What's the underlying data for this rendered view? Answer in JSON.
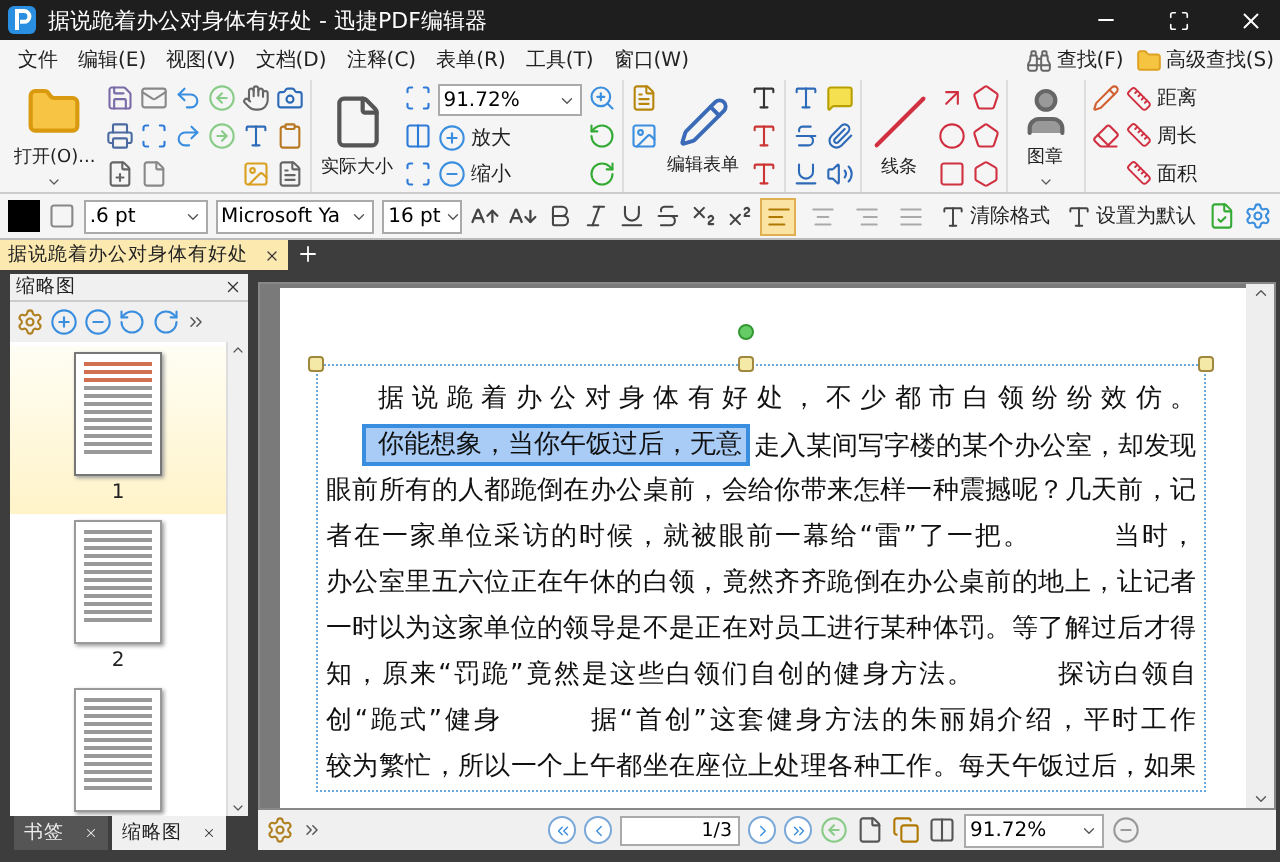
{
  "window": {
    "title": "据说跪着办公对身体有好处 - 迅捷PDF编辑器"
  },
  "menu": [
    "文件",
    "编辑(E)",
    "视图(V)",
    "文档(D)",
    "注释(C)",
    "表单(R)",
    "工具(T)",
    "窗口(W)"
  ],
  "search_links": [
    "查找(F)",
    "高级查找(S)"
  ],
  "ribbon": {
    "open": "打开(O)...",
    "actual_size": "实际大小",
    "zoom_value": "91.72%",
    "zoom_in": "放大",
    "zoom_out": "缩小",
    "edit_form": "编辑表单",
    "lines": "线条",
    "stamp": "图章",
    "measure": [
      "距离",
      "周长",
      "面积"
    ]
  },
  "format_bar": {
    "line_width": ".6 pt",
    "font": "Microsoft Ya",
    "font_size": "16 pt",
    "clear_format": "清除格式",
    "set_default": "设置为默认",
    "alignments": [
      {
        "selected": true
      },
      {
        "selected": false
      },
      {
        "selected": false
      },
      {
        "selected": false
      }
    ]
  },
  "doc_tabs": [
    {
      "label": "据说跪着办公对身体有好处",
      "selected": true
    }
  ],
  "thumbnail_panel": {
    "title": "缩略图",
    "pages": [
      {
        "label": "1",
        "selected": true
      },
      {
        "label": "2",
        "selected": false
      },
      {
        "selected": false
      }
    ]
  },
  "panel_tabs": [
    {
      "label": "书签",
      "selected": false
    },
    {
      "label": "缩略图",
      "selected": true
    }
  ],
  "document": {
    "lines": [
      {
        "text": "据说跪着办公对身体有好处，不少都市白领纷纷效仿。",
        "indent": true
      },
      {
        "highlight": "你能想象，当你午饭过后，无意",
        "text": "走入某间写字楼的某个办公室，却发现",
        "indent": true
      },
      {
        "text": "眼前所有的人都跪倒在办公桌前，会给你带来怎样一种震撼呢？几天前，记"
      },
      {
        "text": "者在一家单位采访的时候，就被眼前一幕给“雷”了一把。        当时，"
      },
      {
        "text": "办公室里五六位正在午休的白领，竟然齐齐跪倒在办公桌前的地上，让记者"
      },
      {
        "text": "一时以为这家单位的领导是不是正在对员工进行某种体罚。等了解过后才得"
      },
      {
        "text": "知，原来“罚跪”竟然是这些白领们自创的健身方法。        探访白领自"
      },
      {
        "text": "创“跪式”健身        据“首创”这套健身方法的朱丽娟介绍，平时工作"
      },
      {
        "text": "较为繁忙，所以一个上午都坐在座位上处理各种工作。每天午饭过后，如果"
      }
    ]
  },
  "status_bar": {
    "page": "1/3",
    "zoom": "91.72%"
  }
}
